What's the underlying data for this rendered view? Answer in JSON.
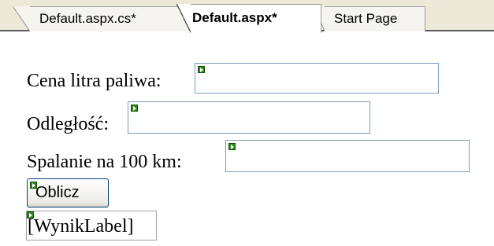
{
  "tabs": [
    {
      "label": "Default.aspx.cs*",
      "active": false
    },
    {
      "label": "Default.aspx*",
      "active": true
    },
    {
      "label": "Start Page",
      "active": false
    }
  ],
  "form": {
    "fuel_price_label": "Cena litra paliwa:",
    "fuel_price_value": "",
    "distance_label": "Odległość:",
    "distance_value": "",
    "consumption_label": "Spalanie na 100 km:",
    "consumption_value": "",
    "calculate_button": "Oblicz",
    "result_label": "[WynikLabel]"
  },
  "colors": {
    "tab_strip": "#ece9d8",
    "textbox_border": "#7f9db9",
    "server_control_glyph": "#2f8a1e"
  },
  "icons": [
    "server-control-glyph-icon"
  ]
}
